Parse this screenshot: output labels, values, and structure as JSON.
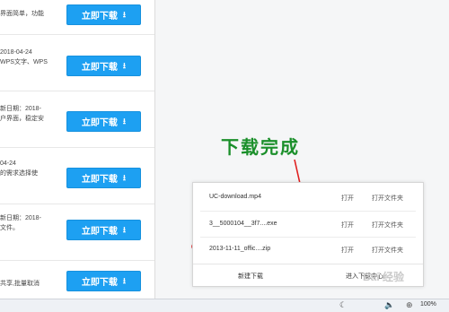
{
  "left_list": {
    "rows": [
      {
        "lines": [
          "界面简单，功能",
          ""
        ],
        "button": "立即下载"
      },
      {
        "lines": [
          "2018-04-24",
          "WPS文字、WPS"
        ],
        "button": "立即下载"
      },
      {
        "lines": [
          "新日期：2018-",
          "户界面，稳定安"
        ],
        "button": "立即下载"
      },
      {
        "lines": [
          "04-24",
          "的需求选择使"
        ],
        "button": "立即下载"
      },
      {
        "lines": [
          "新日期：2018-",
          "文件。"
        ],
        "button": "立即下载"
      },
      {
        "lines": [
          "共享,批量取消",
          ""
        ],
        "button": "立即下载"
      }
    ],
    "download_icon": "download-arrow-icon"
  },
  "annotation": {
    "text": "下载完成",
    "color": "#1a8f2a"
  },
  "download_panel": {
    "items": [
      {
        "filename": "UC-download.mp4",
        "open": "打开",
        "open_folder": "打开文件夹"
      },
      {
        "filename": "3__5000104__3f7....exe",
        "open": "打开",
        "open_folder": "打开文件夹"
      },
      {
        "filename": "2013-11-11_offic....zip",
        "open": "打开",
        "open_folder": "打开文件夹"
      }
    ],
    "footer": {
      "new_download": "新建下载",
      "enter_center": "进入下载中心"
    }
  },
  "status_bar": {
    "icons": [
      "moon-icon",
      "speaker-icon",
      "zoom-icon"
    ],
    "zoom": "100%"
  },
  "watermark": "Bai 经验",
  "colors": {
    "button": "#1da0f2",
    "annotation": "#1a8f2a",
    "ellipse": "#e02020"
  }
}
